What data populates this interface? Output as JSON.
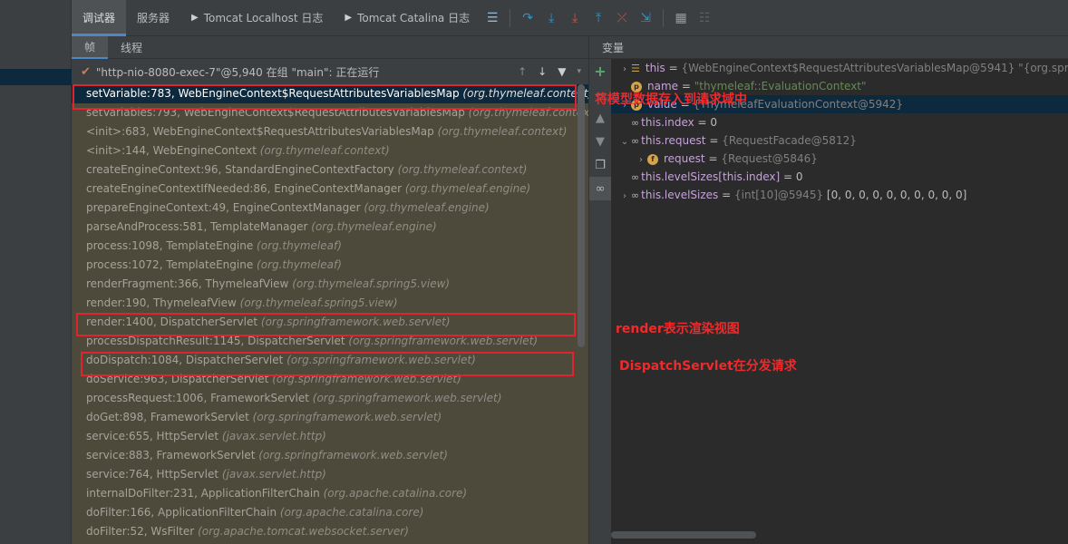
{
  "toolbar": {
    "tabs": [
      {
        "label": "调试器",
        "active": true
      },
      {
        "label": "服务器",
        "active": false
      },
      {
        "label": "Tomcat Localhost 日志",
        "active": false
      },
      {
        "label": "Tomcat Catalina 日志",
        "active": false
      }
    ]
  },
  "frames_panel": {
    "tabs": [
      {
        "label": "帧",
        "active": true
      },
      {
        "label": "线程",
        "active": false
      }
    ],
    "thread_label": "\"http-nio-8080-exec-7\"@5,940 在组 \"main\": 正在运行",
    "frames": [
      {
        "method": "setVariable:783, WebEngineContext$RequestAttributesVariablesMap",
        "pkg": "(org.thymeleaf.context)",
        "selected": true
      },
      {
        "method": "setVariables:793, WebEngineContext$RequestAttributesVariablesMap",
        "pkg": "(org.thymeleaf.context)"
      },
      {
        "method": "<init>:683, WebEngineContext$RequestAttributesVariablesMap",
        "pkg": "(org.thymeleaf.context)"
      },
      {
        "method": "<init>:144, WebEngineContext",
        "pkg": "(org.thymeleaf.context)"
      },
      {
        "method": "createEngineContext:96, StandardEngineContextFactory",
        "pkg": "(org.thymeleaf.context)"
      },
      {
        "method": "createEngineContextIfNeeded:86, EngineContextManager",
        "pkg": "(org.thymeleaf.engine)"
      },
      {
        "method": "prepareEngineContext:49, EngineContextManager",
        "pkg": "(org.thymeleaf.engine)"
      },
      {
        "method": "parseAndProcess:581, TemplateManager",
        "pkg": "(org.thymeleaf.engine)"
      },
      {
        "method": "process:1098, TemplateEngine",
        "pkg": "(org.thymeleaf)"
      },
      {
        "method": "process:1072, TemplateEngine",
        "pkg": "(org.thymeleaf)"
      },
      {
        "method": "renderFragment:366, ThymeleafView",
        "pkg": "(org.thymeleaf.spring5.view)"
      },
      {
        "method": "render:190, ThymeleafView",
        "pkg": "(org.thymeleaf.spring5.view)"
      },
      {
        "method": "render:1400, DispatcherServlet",
        "pkg": "(org.springframework.web.servlet)"
      },
      {
        "method": "processDispatchResult:1145, DispatcherServlet",
        "pkg": "(org.springframework.web.servlet)"
      },
      {
        "method": "doDispatch:1084, DispatcherServlet",
        "pkg": "(org.springframework.web.servlet)"
      },
      {
        "method": "doService:963, DispatcherServlet",
        "pkg": "(org.springframework.web.servlet)"
      },
      {
        "method": "processRequest:1006, FrameworkServlet",
        "pkg": "(org.springframework.web.servlet)"
      },
      {
        "method": "doGet:898, FrameworkServlet",
        "pkg": "(org.springframework.web.servlet)"
      },
      {
        "method": "service:655, HttpServlet",
        "pkg": "(javax.servlet.http)"
      },
      {
        "method": "service:883, FrameworkServlet",
        "pkg": "(org.springframework.web.servlet)"
      },
      {
        "method": "service:764, HttpServlet",
        "pkg": "(javax.servlet.http)"
      },
      {
        "method": "internalDoFilter:231, ApplicationFilterChain",
        "pkg": "(org.apache.catalina.core)"
      },
      {
        "method": "doFilter:166, ApplicationFilterChain",
        "pkg": "(org.apache.catalina.core)"
      },
      {
        "method": "doFilter:52, WsFilter",
        "pkg": "(org.apache.tomcat.websocket.server)"
      }
    ]
  },
  "annotations": {
    "note1": "将模型数据存入到请求域中",
    "note2": "render表示渲染视图",
    "note3": "DispatchServlet在分发请求"
  },
  "vars_panel": {
    "title": "变量",
    "rows": [
      {
        "arrow": "›",
        "icon": "fields-icon",
        "name": "this",
        "value": "{WebEngineContext$RequestAttributesVariablesMap@5941} \"{org.spring"
      },
      {
        "arrow": "",
        "icon": "p",
        "name": "name",
        "value": "\"thymeleaf::EvaluationContext\"",
        "string": true
      },
      {
        "arrow": "›",
        "icon": "p",
        "name": "value",
        "value": "{ThymeleafEvaluationContext@5942}",
        "selected": true
      },
      {
        "arrow": "",
        "icon": "watch",
        "name": "this.index",
        "value": "0",
        "number": true
      },
      {
        "arrow": "⌄",
        "icon": "watch",
        "name": "this.request",
        "value": "{RequestFacade@5812}"
      },
      {
        "arrow": "›",
        "icon": "f",
        "name": "request",
        "value": "{Request@5846}",
        "indent": true
      },
      {
        "arrow": "",
        "icon": "watch",
        "name": "this.levelSizes[this.index]",
        "value": "0",
        "number": true
      },
      {
        "arrow": "›",
        "icon": "watch",
        "name": "this.levelSizes",
        "value": "{int[10]@5945}",
        "extra": "[0, 0, 0, 0, 0, 0, 0, 0, 0, 0]"
      }
    ]
  },
  "colors": {
    "highlight_box": "#e0242d",
    "note_text": "#f02a2a",
    "selection": "#0d293e"
  }
}
